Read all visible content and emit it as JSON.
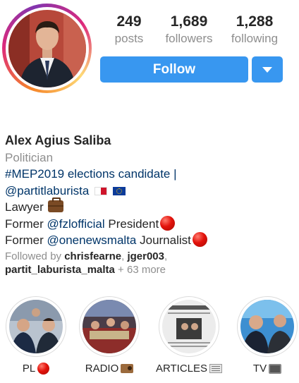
{
  "profile": {
    "stats": {
      "posts": {
        "value": "249",
        "label": "posts"
      },
      "followers": {
        "value": "1,689",
        "label": "followers"
      },
      "following": {
        "value": "1,288",
        "label": "following"
      }
    },
    "follow_label": "Follow"
  },
  "bio": {
    "name": "Alex Agius Saliba",
    "category": "Politician",
    "line1": "#MEP2019 elections candidate |",
    "line2_link": "@partitlaburista",
    "line3": "Lawyer",
    "line4_prefix": "Former ",
    "line4_link": "@fzlofficial",
    "line4_suffix": " President",
    "line5_prefix": "Former ",
    "line5_link": "@onenewsmalta",
    "line5_suffix": " Journalist",
    "followed_by_prefix": "Followed by ",
    "followed_user1": "chrisfearne",
    "followed_sep1": ", ",
    "followed_user2": "jger003",
    "followed_sep2": ",",
    "followed_user3": "partit_laburista_malta",
    "followed_more": " + 63 more"
  },
  "highlights": [
    {
      "label": "PL",
      "icon": "red-circle-icon"
    },
    {
      "label": "RADIO",
      "icon": "radio-icon"
    },
    {
      "label": "ARTICLES",
      "icon": "newspaper-icon"
    },
    {
      "label": "TV",
      "icon": "tv-icon"
    }
  ],
  "colors": {
    "accent": "#3897f0",
    "link": "#003569",
    "muted": "#8e8e8e",
    "text": "#262626"
  }
}
